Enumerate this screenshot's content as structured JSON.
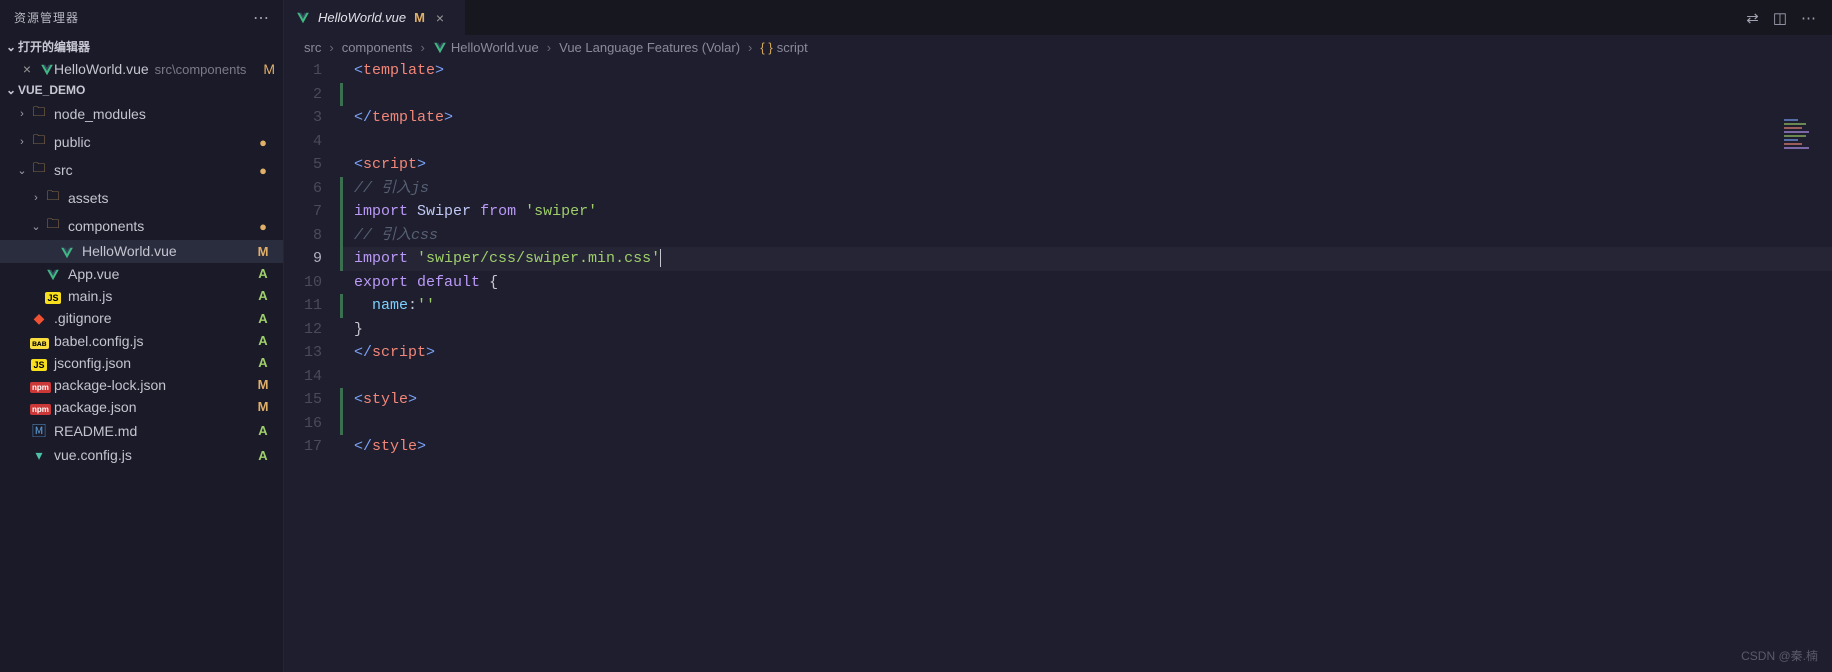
{
  "sidebar": {
    "title": "资源管理器",
    "open_editors_label": "打开的编辑器",
    "open_editors": [
      {
        "name": "HelloWorld.vue",
        "path": "src\\components",
        "status": "M",
        "icon": "vue"
      }
    ],
    "project_name": "VUE_DEMO",
    "tree": [
      {
        "level": 0,
        "type": "folder",
        "open": false,
        "name": "node_modules",
        "status": "",
        "dot": false
      },
      {
        "level": 0,
        "type": "folder",
        "open": false,
        "name": "public",
        "status": "",
        "dot": true
      },
      {
        "level": 0,
        "type": "folder",
        "open": true,
        "name": "src",
        "status": "",
        "dot": true
      },
      {
        "level": 1,
        "type": "folder",
        "open": false,
        "name": "assets",
        "status": "",
        "dot": false
      },
      {
        "level": 1,
        "type": "folder",
        "open": true,
        "name": "components",
        "status": "",
        "dot": true
      },
      {
        "level": 2,
        "type": "file",
        "name": "HelloWorld.vue",
        "status": "M",
        "icon": "vue",
        "selected": true
      },
      {
        "level": 1,
        "type": "file",
        "name": "App.vue",
        "status": "A",
        "icon": "vue"
      },
      {
        "level": 1,
        "type": "file",
        "name": "main.js",
        "status": "A",
        "icon": "js"
      },
      {
        "level": 0,
        "type": "file",
        "name": ".gitignore",
        "status": "A",
        "icon": "git"
      },
      {
        "level": 0,
        "type": "file",
        "name": "babel.config.js",
        "status": "A",
        "icon": "babel"
      },
      {
        "level": 0,
        "type": "file",
        "name": "jsconfig.json",
        "status": "A",
        "icon": "js"
      },
      {
        "level": 0,
        "type": "file",
        "name": "package-lock.json",
        "status": "M",
        "icon": "npm"
      },
      {
        "level": 0,
        "type": "file",
        "name": "package.json",
        "status": "M",
        "icon": "npm"
      },
      {
        "level": 0,
        "type": "file",
        "name": "README.md",
        "status": "A",
        "icon": "md"
      },
      {
        "level": 0,
        "type": "file",
        "name": "vue.config.js",
        "status": "A",
        "icon": "vue2"
      }
    ]
  },
  "tabs": {
    "items": [
      {
        "name": "HelloWorld.vue",
        "status": "M",
        "active": true
      }
    ]
  },
  "breadcrumbs": {
    "items": [
      {
        "label": "src",
        "icon": ""
      },
      {
        "label": "components",
        "icon": ""
      },
      {
        "label": "HelloWorld.vue",
        "icon": "vue"
      },
      {
        "label": "Vue Language Features (Volar)",
        "icon": ""
      },
      {
        "label": "script",
        "icon": "braces"
      }
    ]
  },
  "code": {
    "current_line": 9,
    "lines": [
      {
        "n": 1,
        "html": "<span class='tok-bracket'>&lt;</span><span class='tok-tag'>template</span><span class='tok-bracket'>&gt;</span>"
      },
      {
        "n": 2,
        "html": "",
        "diff": true
      },
      {
        "n": 3,
        "html": "<span class='tok-bracket'>&lt;/</span><span class='tok-tag'>template</span><span class='tok-bracket'>&gt;</span>"
      },
      {
        "n": 4,
        "html": ""
      },
      {
        "n": 5,
        "html": "<span class='tok-bracket'>&lt;</span><span class='tok-tag'>script</span><span class='tok-bracket'>&gt;</span>"
      },
      {
        "n": 6,
        "html": "<span class='tok-comment'>// 引入js</span>",
        "diff": true
      },
      {
        "n": 7,
        "html": "<span class='tok-keyword'>import</span> <span class='tok-class'>Swiper</span> <span class='tok-keyword'>from</span> <span class='tok-string'>'swiper'</span>",
        "diff": true
      },
      {
        "n": 8,
        "html": "<span class='tok-comment'>// 引入css</span>",
        "diff": true
      },
      {
        "n": 9,
        "html": "<span class='tok-keyword'>import</span> <span class='tok-string'>'swiper/css/swiper.min.css'</span><span class='cursor-line'></span>",
        "diff": true,
        "current": true
      },
      {
        "n": 10,
        "html": "<span class='tok-keyword'>export</span> <span class='tok-keyword'>default</span> <span class='tok-plain'>{</span>"
      },
      {
        "n": 11,
        "html": "  <span class='tok-prop'>name</span><span class='tok-plain'>:</span><span class='tok-string'>''</span>",
        "diff": true
      },
      {
        "n": 12,
        "html": "<span class='tok-plain'>}</span>"
      },
      {
        "n": 13,
        "html": "<span class='tok-bracket'>&lt;/</span><span class='tok-tag'>script</span><span class='tok-bracket'>&gt;</span>"
      },
      {
        "n": 14,
        "html": ""
      },
      {
        "n": 15,
        "html": "<span class='tok-bracket'>&lt;</span><span class='tok-tag'>style</span><span class='tok-bracket'>&gt;</span>",
        "diff": true
      },
      {
        "n": 16,
        "html": "",
        "diff": true
      },
      {
        "n": 17,
        "html": "<span class='tok-bracket'>&lt;/</span><span class='tok-tag'>style</span><span class='tok-bracket'>&gt;</span>"
      }
    ]
  },
  "watermark": "CSDN @秦.楠"
}
